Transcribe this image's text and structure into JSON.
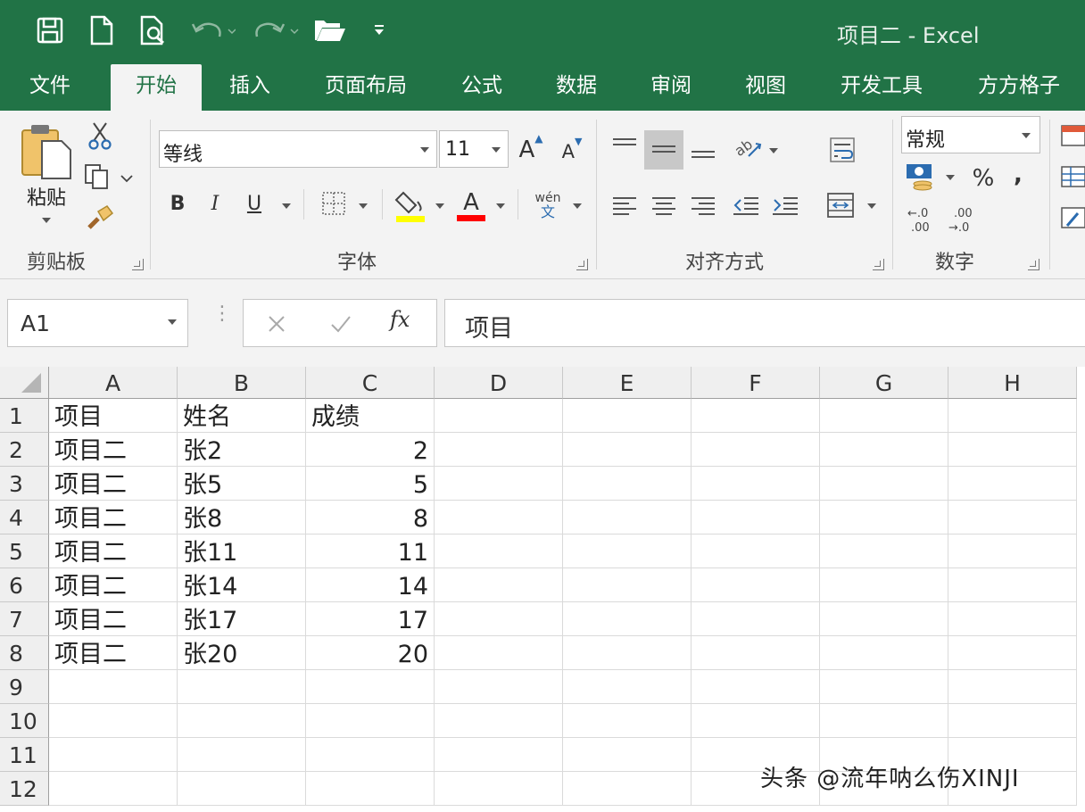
{
  "window": {
    "title": "项目二 - Excel"
  },
  "tabs": [
    "文件",
    "开始",
    "插入",
    "页面布局",
    "公式",
    "数据",
    "审阅",
    "视图",
    "开发工具",
    "方方格子"
  ],
  "ribbon": {
    "clipboard": {
      "paste_label": "粘贴",
      "group_label": "剪贴板"
    },
    "font": {
      "font_name": "等线",
      "font_size": "11",
      "group_label": "字体",
      "bold": "B",
      "italic": "I",
      "underline": "U",
      "grow": "A",
      "shrink": "A",
      "font_color_letter": "A",
      "fill_color": "#ffff00",
      "font_color": "#ff0000",
      "phonetic_top": "wén",
      "phonetic_bottom": "文"
    },
    "alignment": {
      "group_label": "对齐方式"
    },
    "number": {
      "format": "常规",
      "group_label": "数字",
      "percent": "%",
      "comma": ",",
      "inc_decimal": "←.0 .00",
      "dec_decimal": ".00 →.0"
    }
  },
  "formula_bar": {
    "name_box": "A1",
    "fx": "fx",
    "content": "项目"
  },
  "sheet": {
    "columns": [
      "A",
      "B",
      "C",
      "D",
      "E",
      "F",
      "G",
      "H"
    ],
    "rows": [
      "1",
      "2",
      "3",
      "4",
      "5",
      "6",
      "7",
      "8",
      "9",
      "10",
      "11",
      "12"
    ],
    "data": [
      [
        "项目",
        "姓名",
        "成绩"
      ],
      [
        "项目二",
        "张2",
        "2"
      ],
      [
        "项目二",
        "张5",
        "5"
      ],
      [
        "项目二",
        "张8",
        "8"
      ],
      [
        "项目二",
        "张11",
        "11"
      ],
      [
        "项目二",
        "张14",
        "14"
      ],
      [
        "项目二",
        "张17",
        "17"
      ],
      [
        "项目二",
        "张20",
        "20"
      ]
    ]
  },
  "watermark": "头条 @流年呐么伤XINJI"
}
